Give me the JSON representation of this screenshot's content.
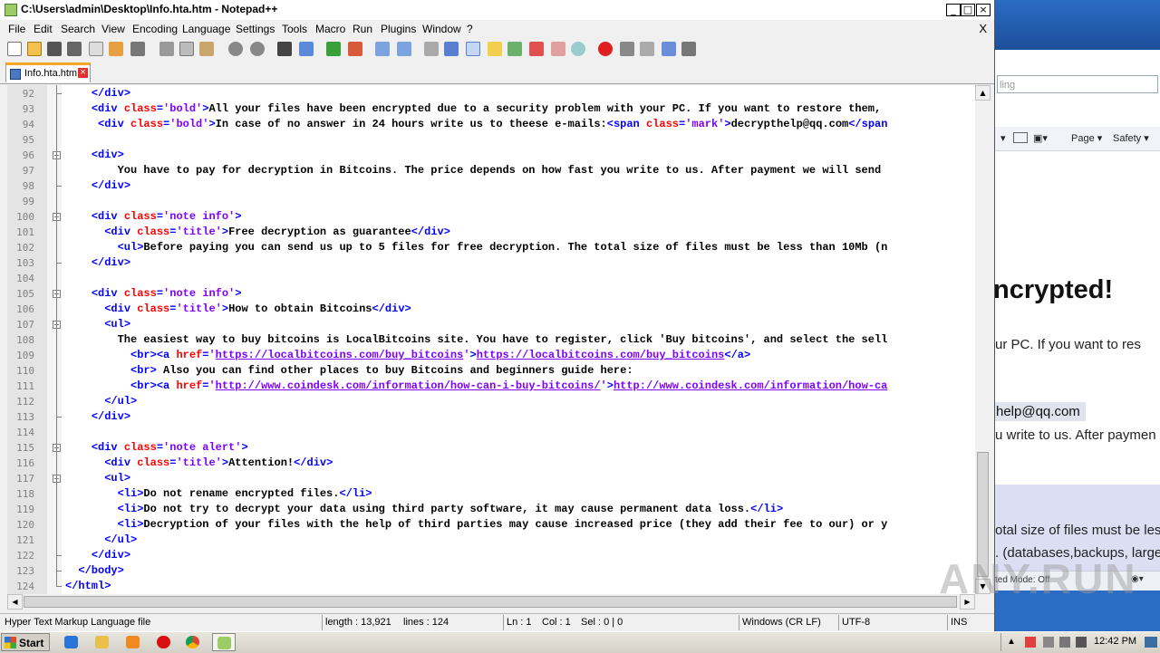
{
  "window": {
    "title": "C:\\Users\\admin\\Desktop\\Info.hta.htm - Notepad++",
    "min": "_",
    "max": "□",
    "close": "×"
  },
  "menu": [
    "File",
    "Edit",
    "Search",
    "View",
    "Encoding",
    "Language",
    "Settings",
    "Tools",
    "Macro",
    "Run",
    "Plugins",
    "Window",
    "?"
  ],
  "menu_close": "X",
  "tab": {
    "label": "Info.hta.htm",
    "close": "×"
  },
  "editor": {
    "line_numbers": [
      "92",
      "93",
      "94",
      "95",
      "96",
      "97",
      "98",
      "99",
      "100",
      "101",
      "102",
      "103",
      "104",
      "105",
      "106",
      "107",
      "108",
      "109",
      "110",
      "111",
      "112",
      "113",
      "114",
      "115",
      "116",
      "117",
      "118",
      "119",
      "120",
      "121",
      "122",
      "123",
      "124"
    ],
    "code": [
      "    </div>",
      "    <div class='bold'>All your files have been encrypted due to a security problem with your PC. If you want to restore them,",
      "     <div class='bold'>In case of no answer in 24 hours write us to theese e-mails:<span class='mark'>decrypthelp@qq.com</span",
      "",
      "    <div>",
      "        You have to pay for decryption in Bitcoins. The price depends on how fast you write to us. After payment we will send",
      "    </div>",
      "",
      "    <div class='note info'>",
      "      <div class='title'>Free decryption as guarantee</div>",
      "        <ul>Before paying you can send us up to 5 files for free decryption. The total size of files must be less than 10Mb (n",
      "    </div>",
      "",
      "    <div class='note info'>",
      "      <div class='title'>How to obtain Bitcoins</div>",
      "      <ul>",
      "        The easiest way to buy bitcoins is LocalBitcoins site. You have to register, click 'Buy bitcoins', and select the sell",
      "          <br><a href='https://localbitcoins.com/buy_bitcoins'>https://localbitcoins.com/buy_bitcoins</a>",
      "          <br> Also you can find other places to buy Bitcoins and beginners guide here:",
      "          <br><a href='http://www.coindesk.com/information/how-can-i-buy-bitcoins/'>http://www.coindesk.com/information/how-ca",
      "      </ul>",
      "    </div>",
      "",
      "    <div class='note alert'>",
      "      <div class='title'>Attention!</div>",
      "      <ul>",
      "        <li>Do not rename encrypted files.</li>",
      "        <li>Do not try to decrypt your data using third party software, it may cause permanent data loss.</li>",
      "        <li>Decryption of your files with the help of third parties may cause increased price (they add their fee to our) or y",
      "      </ul>",
      "    </div>",
      "  </body>",
      "</html>"
    ]
  },
  "status": {
    "file_type": "Hyper Text Markup Language file",
    "length": "length : 13,921",
    "lines": "lines : 124",
    "ln": "Ln : 1",
    "col": "Col : 1",
    "sel": "Sel : 0 | 0",
    "eol": "Windows (CR LF)",
    "encoding": "UTF-8",
    "mode": "INS"
  },
  "background_window": {
    "search_text": "ling",
    "page_menu": "Page ▾",
    "safety_menu": "Safety ▾",
    "heading": "ncrypted!",
    "line1": "ur PC. If you want to res",
    "email": "help@qq.com",
    "line2": "u write to us. After paymen",
    "line3": "otal size of files must be less",
    "line4": ". (databases,backups, large",
    "status_text": "ted Mode: Off"
  },
  "watermark": "ANY.RUN",
  "taskbar": {
    "start_label": "Start",
    "clock": "12:42 PM"
  },
  "colors": {
    "tag": "#0000ff",
    "attr": "#ff0000",
    "value": "#8000ff",
    "tab_accent": "#f5a623",
    "desktop": "#3a6ea5"
  }
}
